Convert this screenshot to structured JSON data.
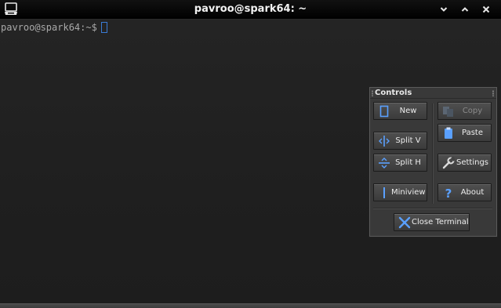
{
  "window": {
    "title": "pavroo@spark64: ~"
  },
  "titlebar": {
    "icon": "terminal-icon",
    "buttons": [
      {
        "name": "minimize",
        "icon": "chevron-down-icon"
      },
      {
        "name": "maximize",
        "icon": "chevron-up-icon"
      },
      {
        "name": "close",
        "icon": "close-icon"
      }
    ]
  },
  "terminal": {
    "prompt": "pavroo@spark64:~$",
    "input": ""
  },
  "controls": {
    "title": "Controls",
    "buttons": {
      "new": {
        "label": "New",
        "icon": "new-terminal-icon"
      },
      "copy": {
        "label": "Copy",
        "icon": "copy-icon",
        "enabled": false
      },
      "paste": {
        "label": "Paste",
        "icon": "paste-icon"
      },
      "split_v": {
        "label": "Split V",
        "icon": "split-vertical-icon"
      },
      "split_h": {
        "label": "Split H",
        "icon": "split-horizontal-icon"
      },
      "settings": {
        "label": "Settings",
        "icon": "wrench-icon"
      },
      "miniview": {
        "label": "Miniview",
        "icon": "miniview-icon"
      },
      "about": {
        "label": "About",
        "icon": "help-icon"
      },
      "close_terminal": {
        "label": "Close Terminal",
        "icon": "close-x-icon"
      }
    }
  },
  "colors": {
    "accent": "#3a7bd5",
    "background": "#1e1e1e",
    "panel": "#393939",
    "text": "#ececec"
  }
}
